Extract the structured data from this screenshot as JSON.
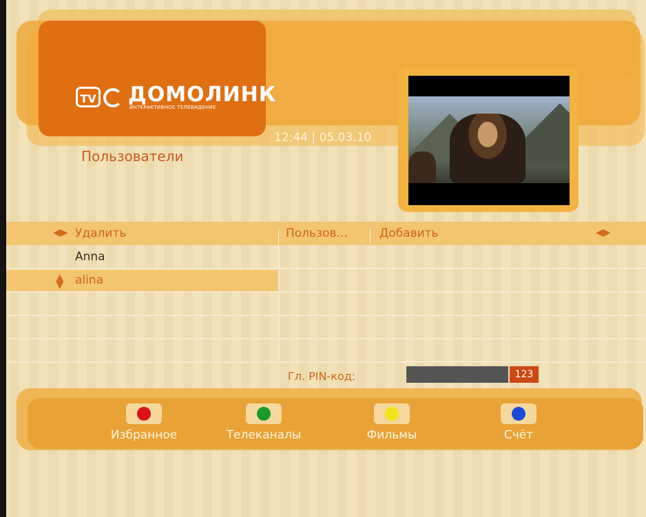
{
  "brand": {
    "badge": "TV",
    "name": "ДОМОЛИНК",
    "tagline": "ИНТЕРАКТИВНОЕ ТЕЛЕВИДЕНИЕ"
  },
  "datetime": "12:44 | 05.03.10",
  "page_title": "Пользователи",
  "table": {
    "header": {
      "delete_label": "Удалить",
      "users_label": "Пользов...",
      "add_label": "Добавить"
    },
    "rows": [
      {
        "name": "Anna",
        "selected": false
      },
      {
        "name": "alina",
        "selected": true
      },
      {
        "name": ""
      },
      {
        "name": ""
      },
      {
        "name": ""
      }
    ]
  },
  "pin": {
    "label": "Гл. PIN-код:",
    "value": "123"
  },
  "function_keys": [
    {
      "label": "Избранное",
      "color_name": "red",
      "color": "#e0101a"
    },
    {
      "label": "Телеканалы",
      "color_name": "green",
      "color": "#1a9a2a"
    },
    {
      "label": "Фильмы",
      "color_name": "yellow",
      "color": "#f2e416"
    },
    {
      "label": "Счёт",
      "color_name": "blue",
      "color": "#1a4ad8"
    }
  ],
  "colors": {
    "accent_orange": "#d0651a",
    "logo_bg": "#e06f12",
    "highlight_row": "#f3c571"
  }
}
